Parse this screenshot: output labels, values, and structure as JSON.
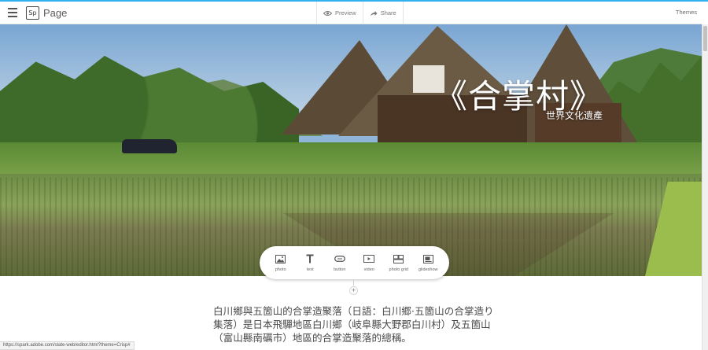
{
  "topbar": {
    "logo_mark": "Sp",
    "logo_text": "Page",
    "preview_label": "Preview",
    "share_label": "Share",
    "themes_label": "Themes"
  },
  "hero": {
    "title": "《合掌村》",
    "subtitle": "世界文化遺產"
  },
  "toolbox": {
    "items": [
      {
        "label": "photo",
        "icon": "photo-icon"
      },
      {
        "label": "text",
        "icon": "text-icon"
      },
      {
        "label": "button",
        "icon": "button-icon"
      },
      {
        "label": "video",
        "icon": "video-icon"
      },
      {
        "label": "photo grid",
        "icon": "photo-grid-icon"
      },
      {
        "label": "glideshow",
        "icon": "glideshow-icon"
      }
    ]
  },
  "add_block": {
    "symbol": "+"
  },
  "content": {
    "paragraph": "白川鄉與五箇山的合掌造聚落（日語：白川郷·五箇山の合掌造り集落）是日本飛驒地區白川鄉（岐阜縣大野郡白川村）及五箇山（富山縣南礪市）地區的合掌造聚落的總稱。"
  },
  "status_bar": {
    "url": "https://spark.adobe.com/slate-web/editor.html?theme=Crisp#"
  },
  "colors": {
    "accent_line": "#2fb0f0",
    "text": "#4a4a4a"
  }
}
